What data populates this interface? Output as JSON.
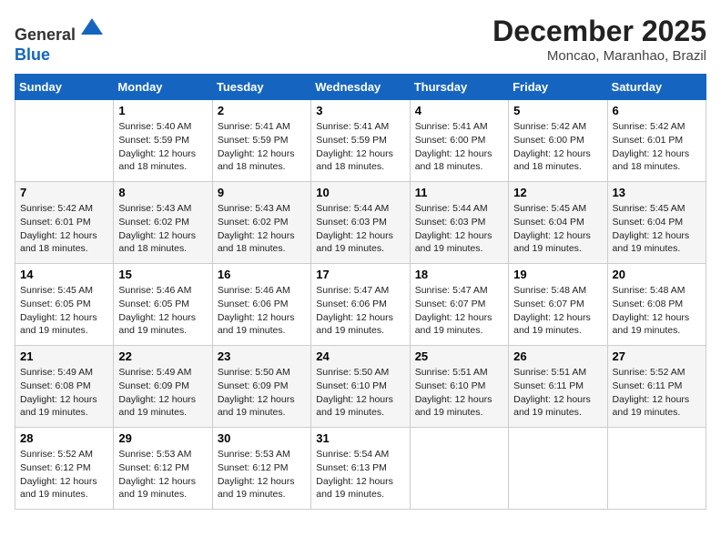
{
  "header": {
    "logo_line1": "General",
    "logo_line2": "Blue",
    "month_year": "December 2025",
    "location": "Moncao, Maranhao, Brazil"
  },
  "days_of_week": [
    "Sunday",
    "Monday",
    "Tuesday",
    "Wednesday",
    "Thursday",
    "Friday",
    "Saturday"
  ],
  "weeks": [
    [
      {
        "day": "",
        "info": ""
      },
      {
        "day": "1",
        "info": "Sunrise: 5:40 AM\nSunset: 5:59 PM\nDaylight: 12 hours\nand 18 minutes."
      },
      {
        "day": "2",
        "info": "Sunrise: 5:41 AM\nSunset: 5:59 PM\nDaylight: 12 hours\nand 18 minutes."
      },
      {
        "day": "3",
        "info": "Sunrise: 5:41 AM\nSunset: 5:59 PM\nDaylight: 12 hours\nand 18 minutes."
      },
      {
        "day": "4",
        "info": "Sunrise: 5:41 AM\nSunset: 6:00 PM\nDaylight: 12 hours\nand 18 minutes."
      },
      {
        "day": "5",
        "info": "Sunrise: 5:42 AM\nSunset: 6:00 PM\nDaylight: 12 hours\nand 18 minutes."
      },
      {
        "day": "6",
        "info": "Sunrise: 5:42 AM\nSunset: 6:01 PM\nDaylight: 12 hours\nand 18 minutes."
      }
    ],
    [
      {
        "day": "7",
        "info": "Sunrise: 5:42 AM\nSunset: 6:01 PM\nDaylight: 12 hours\nand 18 minutes."
      },
      {
        "day": "8",
        "info": "Sunrise: 5:43 AM\nSunset: 6:02 PM\nDaylight: 12 hours\nand 18 minutes."
      },
      {
        "day": "9",
        "info": "Sunrise: 5:43 AM\nSunset: 6:02 PM\nDaylight: 12 hours\nand 18 minutes."
      },
      {
        "day": "10",
        "info": "Sunrise: 5:44 AM\nSunset: 6:03 PM\nDaylight: 12 hours\nand 19 minutes."
      },
      {
        "day": "11",
        "info": "Sunrise: 5:44 AM\nSunset: 6:03 PM\nDaylight: 12 hours\nand 19 minutes."
      },
      {
        "day": "12",
        "info": "Sunrise: 5:45 AM\nSunset: 6:04 PM\nDaylight: 12 hours\nand 19 minutes."
      },
      {
        "day": "13",
        "info": "Sunrise: 5:45 AM\nSunset: 6:04 PM\nDaylight: 12 hours\nand 19 minutes."
      }
    ],
    [
      {
        "day": "14",
        "info": "Sunrise: 5:45 AM\nSunset: 6:05 PM\nDaylight: 12 hours\nand 19 minutes."
      },
      {
        "day": "15",
        "info": "Sunrise: 5:46 AM\nSunset: 6:05 PM\nDaylight: 12 hours\nand 19 minutes."
      },
      {
        "day": "16",
        "info": "Sunrise: 5:46 AM\nSunset: 6:06 PM\nDaylight: 12 hours\nand 19 minutes."
      },
      {
        "day": "17",
        "info": "Sunrise: 5:47 AM\nSunset: 6:06 PM\nDaylight: 12 hours\nand 19 minutes."
      },
      {
        "day": "18",
        "info": "Sunrise: 5:47 AM\nSunset: 6:07 PM\nDaylight: 12 hours\nand 19 minutes."
      },
      {
        "day": "19",
        "info": "Sunrise: 5:48 AM\nSunset: 6:07 PM\nDaylight: 12 hours\nand 19 minutes."
      },
      {
        "day": "20",
        "info": "Sunrise: 5:48 AM\nSunset: 6:08 PM\nDaylight: 12 hours\nand 19 minutes."
      }
    ],
    [
      {
        "day": "21",
        "info": "Sunrise: 5:49 AM\nSunset: 6:08 PM\nDaylight: 12 hours\nand 19 minutes."
      },
      {
        "day": "22",
        "info": "Sunrise: 5:49 AM\nSunset: 6:09 PM\nDaylight: 12 hours\nand 19 minutes."
      },
      {
        "day": "23",
        "info": "Sunrise: 5:50 AM\nSunset: 6:09 PM\nDaylight: 12 hours\nand 19 minutes."
      },
      {
        "day": "24",
        "info": "Sunrise: 5:50 AM\nSunset: 6:10 PM\nDaylight: 12 hours\nand 19 minutes."
      },
      {
        "day": "25",
        "info": "Sunrise: 5:51 AM\nSunset: 6:10 PM\nDaylight: 12 hours\nand 19 minutes."
      },
      {
        "day": "26",
        "info": "Sunrise: 5:51 AM\nSunset: 6:11 PM\nDaylight: 12 hours\nand 19 minutes."
      },
      {
        "day": "27",
        "info": "Sunrise: 5:52 AM\nSunset: 6:11 PM\nDaylight: 12 hours\nand 19 minutes."
      }
    ],
    [
      {
        "day": "28",
        "info": "Sunrise: 5:52 AM\nSunset: 6:12 PM\nDaylight: 12 hours\nand 19 minutes."
      },
      {
        "day": "29",
        "info": "Sunrise: 5:53 AM\nSunset: 6:12 PM\nDaylight: 12 hours\nand 19 minutes."
      },
      {
        "day": "30",
        "info": "Sunrise: 5:53 AM\nSunset: 6:12 PM\nDaylight: 12 hours\nand 19 minutes."
      },
      {
        "day": "31",
        "info": "Sunrise: 5:54 AM\nSunset: 6:13 PM\nDaylight: 12 hours\nand 19 minutes."
      },
      {
        "day": "",
        "info": ""
      },
      {
        "day": "",
        "info": ""
      },
      {
        "day": "",
        "info": ""
      }
    ]
  ]
}
